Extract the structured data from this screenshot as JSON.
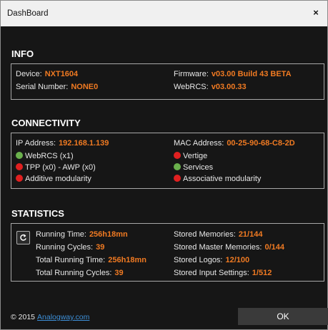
{
  "window": {
    "title": "DashBoard",
    "close_label": "×"
  },
  "info": {
    "title": "INFO",
    "device_label": "Device:",
    "device_value": "NXT1604",
    "serial_label": "Serial Number:",
    "serial_value": "NONE0",
    "firmware_label": "Firmware:",
    "firmware_value": "v03.00 Build 43 BETA",
    "webrcs_label": "WebRCS:",
    "webrcs_value": "v03.00.33"
  },
  "connectivity": {
    "title": "CONNECTIVITY",
    "ip_label": "IP Address:",
    "ip_value": "192.168.1.139",
    "mac_label": "MAC Address:",
    "mac_value": "00-25-90-68-C8-2D",
    "left_items": [
      {
        "label": "WebRCS (x1)",
        "status": "green"
      },
      {
        "label": "TPP (x0) - AWP (x0)",
        "status": "red"
      },
      {
        "label": "Additive modularity",
        "status": "red"
      }
    ],
    "right_items": [
      {
        "label": "Vertige",
        "status": "red"
      },
      {
        "label": "Services",
        "status": "green"
      },
      {
        "label": "Associative modularity",
        "status": "red"
      }
    ]
  },
  "statistics": {
    "title": "STATISTICS",
    "running_time_label": "Running Time:",
    "running_time_value": "256h18mn",
    "running_cycles_label": "Running Cycles:",
    "running_cycles_value": "39",
    "total_running_time_label": "Total Running Time:",
    "total_running_time_value": "256h18mn",
    "total_running_cycles_label": "Total Running Cycles:",
    "total_running_cycles_value": "39",
    "stored_memories_label": "Stored Memories:",
    "stored_memories_value": "21/144",
    "stored_master_label": "Stored Master Memories:",
    "stored_master_value": "0/144",
    "stored_logos_label": "Stored Logos:",
    "stored_logos_value": "12/100",
    "stored_inputs_label": "Stored Input Settings:",
    "stored_inputs_value": "1/512",
    "refresh_icon": "refresh-icon"
  },
  "footer": {
    "copyright": "© 2015",
    "link_text": "Analogway.com",
    "ok_label": "OK"
  },
  "colors": {
    "accent": "#f07a22",
    "status_green": "#6ab04c",
    "status_red": "#e02020",
    "background": "#161616",
    "link": "#3d8fd8"
  }
}
